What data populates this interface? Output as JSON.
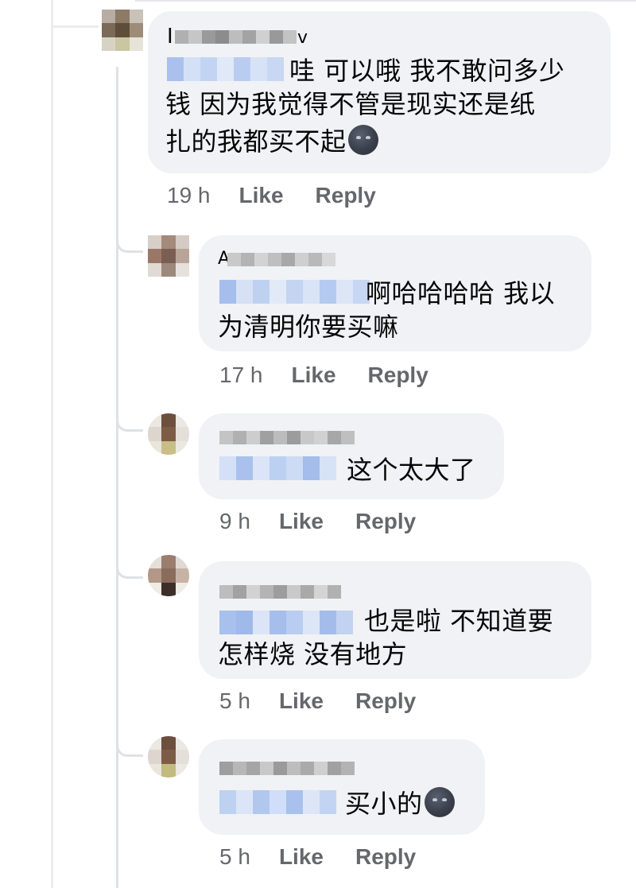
{
  "comments": [
    {
      "name_prefix": "I",
      "name_suffix": "v",
      "body_lines": [
        "哇 可以哦 我不敢问多少",
        "钱 因为我觉得不管是现实还是纸",
        "扎的我都买不起"
      ],
      "emoji": "new-moon-face-icon",
      "time": "19 h",
      "like_label": "Like",
      "reply_label": "Reply"
    },
    {
      "name_prefix": "A",
      "body_lines": [
        "啊哈哈哈哈 我以",
        "为清明你要买嘛"
      ],
      "time": "17 h",
      "like_label": "Like",
      "reply_label": "Reply"
    },
    {
      "body_lines": [
        "这个太大了"
      ],
      "time": "9 h",
      "like_label": "Like",
      "reply_label": "Reply"
    },
    {
      "body_lines": [
        "也是啦 不知道要",
        "怎样烧 没有地方"
      ],
      "time": "5 h",
      "like_label": "Like",
      "reply_label": "Reply"
    },
    {
      "body_lines": [
        "买小的"
      ],
      "emoji": "new-moon-face-icon",
      "time": "5 h",
      "like_label": "Like",
      "reply_label": "Reply"
    }
  ],
  "colors": {
    "bubble": "#f0f2f5",
    "meta_text": "#65676b",
    "mention_blur": "#bcd0f2",
    "name_blur": "#9a9a9a",
    "thread_line": "#dfe1e5"
  }
}
